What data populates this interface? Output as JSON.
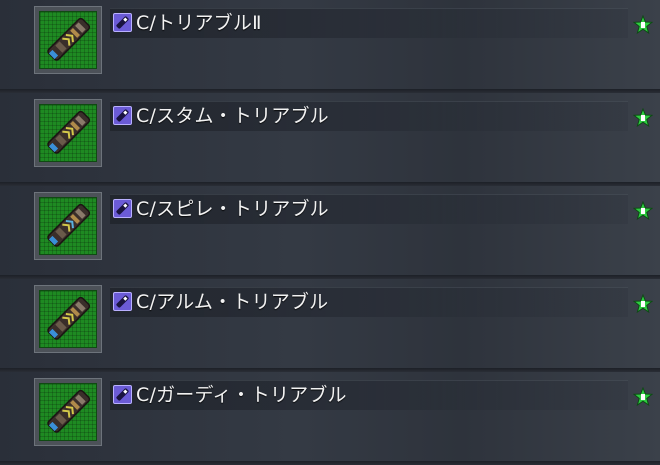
{
  "items": [
    {
      "name": "C/トリアブルⅡ",
      "icon": "chip-icon",
      "type_icon": "c-chip-type-icon",
      "rarity_badge": "star-badge-icon"
    },
    {
      "name": "C/スタム・トリアブル",
      "icon": "chip-icon",
      "type_icon": "c-chip-type-icon",
      "rarity_badge": "star-badge-icon"
    },
    {
      "name": "C/スピレ・トリアブル",
      "icon": "chip-icon",
      "type_icon": "c-chip-type-icon",
      "rarity_badge": "star-badge-icon"
    },
    {
      "name": "C/アルム・トリアブル",
      "icon": "chip-icon",
      "type_icon": "c-chip-type-icon",
      "rarity_badge": "star-badge-icon"
    },
    {
      "name": "C/ガーディ・トリアブル",
      "icon": "chip-icon",
      "type_icon": "c-chip-type-icon",
      "rarity_badge": "star-badge-icon"
    }
  ],
  "colors": {
    "thumb_bg": "#1e8a22",
    "type_icon_bg": "#6b5bd6",
    "badge_star": "#2ecc40"
  }
}
